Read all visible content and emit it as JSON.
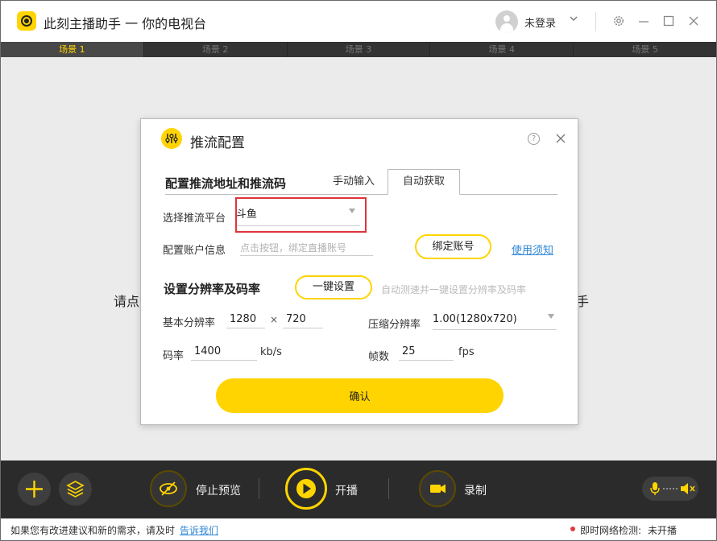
{
  "app": {
    "title": "此刻主播助手 一 你的电视台",
    "login_status": "未登录"
  },
  "icons": {
    "logo": "app-logo-icon",
    "avatar": "user-avatar-icon",
    "user_menu": "chevron-down-icon",
    "settings": "gear-icon",
    "minimize": "minimize-icon",
    "maximize": "maximize-icon",
    "close": "close-icon",
    "add": "plus-icon",
    "layers": "layers-icon",
    "preview": "eye-slash-icon",
    "live": "play-icon",
    "record": "camera-icon",
    "mic": "microphone-icon",
    "speaker": "speaker-mute-icon",
    "dialog": "sliders-icon",
    "help": "question-icon"
  },
  "colors": {
    "accent": "#ffd400",
    "highlight": "#e0333a",
    "link": "#2f86d6"
  },
  "scenes": [
    {
      "label": "场景 1",
      "active": true
    },
    {
      "label": "场景 2",
      "active": false
    },
    {
      "label": "场景 3",
      "active": false
    },
    {
      "label": "场景 4",
      "active": false
    },
    {
      "label": "场景 5",
      "active": false
    }
  ],
  "canvas": {
    "hint_left": "请点",
    "hint_right": "手"
  },
  "dialog": {
    "title": "推流配置",
    "help_glyph": "?",
    "section1_title": "配置推流地址和推流码",
    "tabs": [
      {
        "label": "手动输入",
        "active": false
      },
      {
        "label": "自动获取",
        "active": true
      }
    ],
    "platform_label": "选择推流平台",
    "platform_value": "斗鱼",
    "account_label": "配置账户信息",
    "account_placeholder": "点击按钮，绑定直播账号",
    "bind_button": "绑定账号",
    "notice_link": "使用须知",
    "section2_title": "设置分辨率及码率",
    "oneclick_button": "一键设置",
    "oneclick_hint": "自动测速并一键设置分辨率及码率",
    "resolution_label": "基本分辨率",
    "res_width": "1280",
    "res_times": "×",
    "res_height": "720",
    "compress_label": "压缩分辨率",
    "compress_value": "1.00(1280x720)",
    "bitrate_label": "码率",
    "bitrate_value": "1400",
    "bitrate_unit": "kb/s",
    "fps_label": "帧数",
    "fps_value": "25",
    "fps_unit": "fps",
    "confirm_button": "确认"
  },
  "bottom": {
    "preview_label": "停止预览",
    "live_label": "开播",
    "record_label": "录制"
  },
  "status": {
    "feedback_text": "如果您有改进建议和新的需求，请及时",
    "feedback_link": "告诉我们",
    "net_label": "即时网络检测:",
    "net_value": "未开播"
  }
}
